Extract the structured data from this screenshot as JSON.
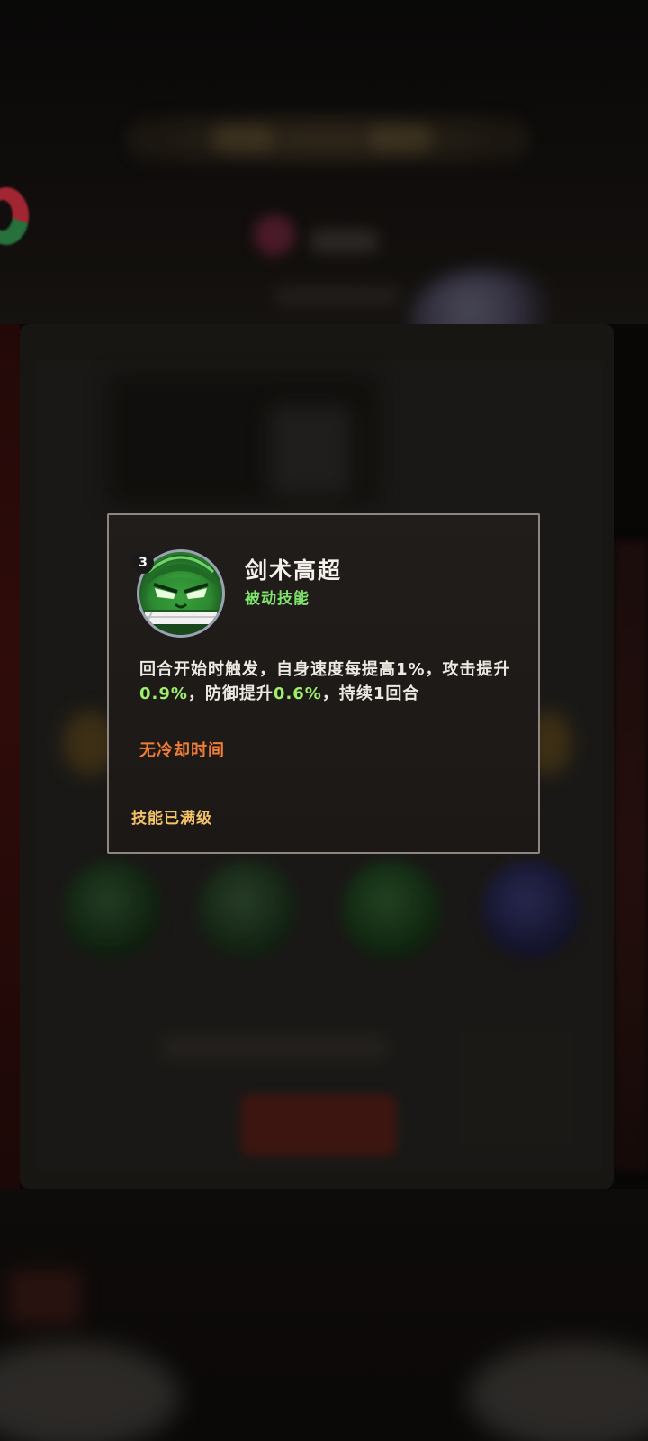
{
  "skill_tooltip": {
    "icon": "green-masked-ninja-icon",
    "level": "3",
    "name": "剑术高超",
    "type": "被动技能",
    "description_parts": {
      "p1": "回合开始时触发，自身速度每提高1%，攻击提升",
      "atk": "0.9%",
      "p2": "，防御提升",
      "def": "0.6%",
      "p3": "，持续1回合"
    },
    "cooldown": "无冷却时间",
    "status": "技能已满级"
  },
  "colors": {
    "skill_type": "#7fe36a",
    "highlight": "#9ef06a",
    "cooldown": "#f07d35",
    "status": "#f4c365",
    "border": "#8e8680"
  }
}
